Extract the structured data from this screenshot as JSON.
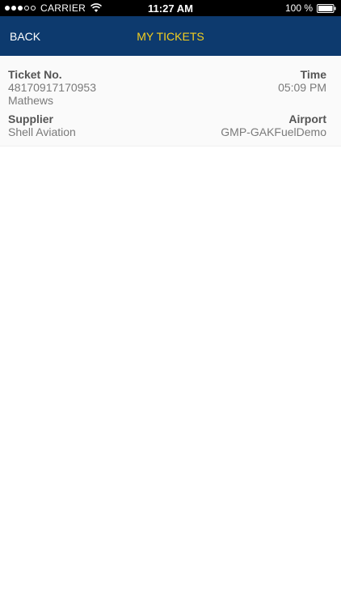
{
  "status_bar": {
    "carrier": "CARRIER",
    "time": "11:27 AM",
    "battery": "100 %",
    "signal_bars_filled": 3,
    "signal_bars_total": 5
  },
  "nav": {
    "back_label": "BACK",
    "title": "MY TICKETS",
    "background_color": "#0d3a6e",
    "title_color": "#f5cf1e"
  },
  "tickets": [
    {
      "ticket_no_label": "Ticket No.",
      "ticket_no": "48170917170953",
      "customer": "Mathews",
      "time_label": "Time",
      "time": "05:09 PM",
      "supplier_label": "Supplier",
      "supplier": "Shell Aviation",
      "airport_label": "Airport",
      "airport": "GMP-GAKFuelDemo"
    }
  ]
}
